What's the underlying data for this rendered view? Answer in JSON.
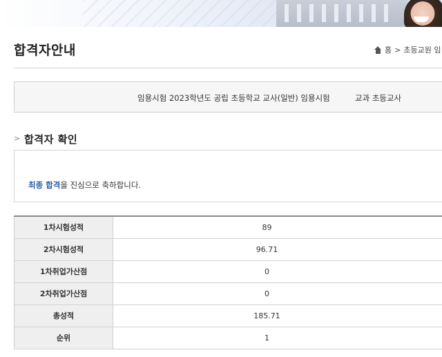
{
  "header": {
    "page_title": "합격자안내",
    "breadcrumb": [
      "홈",
      "초등교원 임"
    ]
  },
  "exam_info": {
    "exam_name": "임용시험  2023학년도 공립 초등학교 교사(일반) 임용시험",
    "subject": "교과  초등교사"
  },
  "section": {
    "title": "합격자 확인"
  },
  "message": {
    "highlight": "최종 합격",
    "rest": "을 진심으로 축하합니다."
  },
  "results": [
    {
      "label": "1차시험성적",
      "value": "89"
    },
    {
      "label": "2차시험성적",
      "value": "96.71"
    },
    {
      "label": "1차취업가산점",
      "value": "0"
    },
    {
      "label": "2차취업가산점",
      "value": "0"
    },
    {
      "label": "총성적",
      "value": "185.71"
    },
    {
      "label": "순위",
      "value": "1"
    }
  ]
}
